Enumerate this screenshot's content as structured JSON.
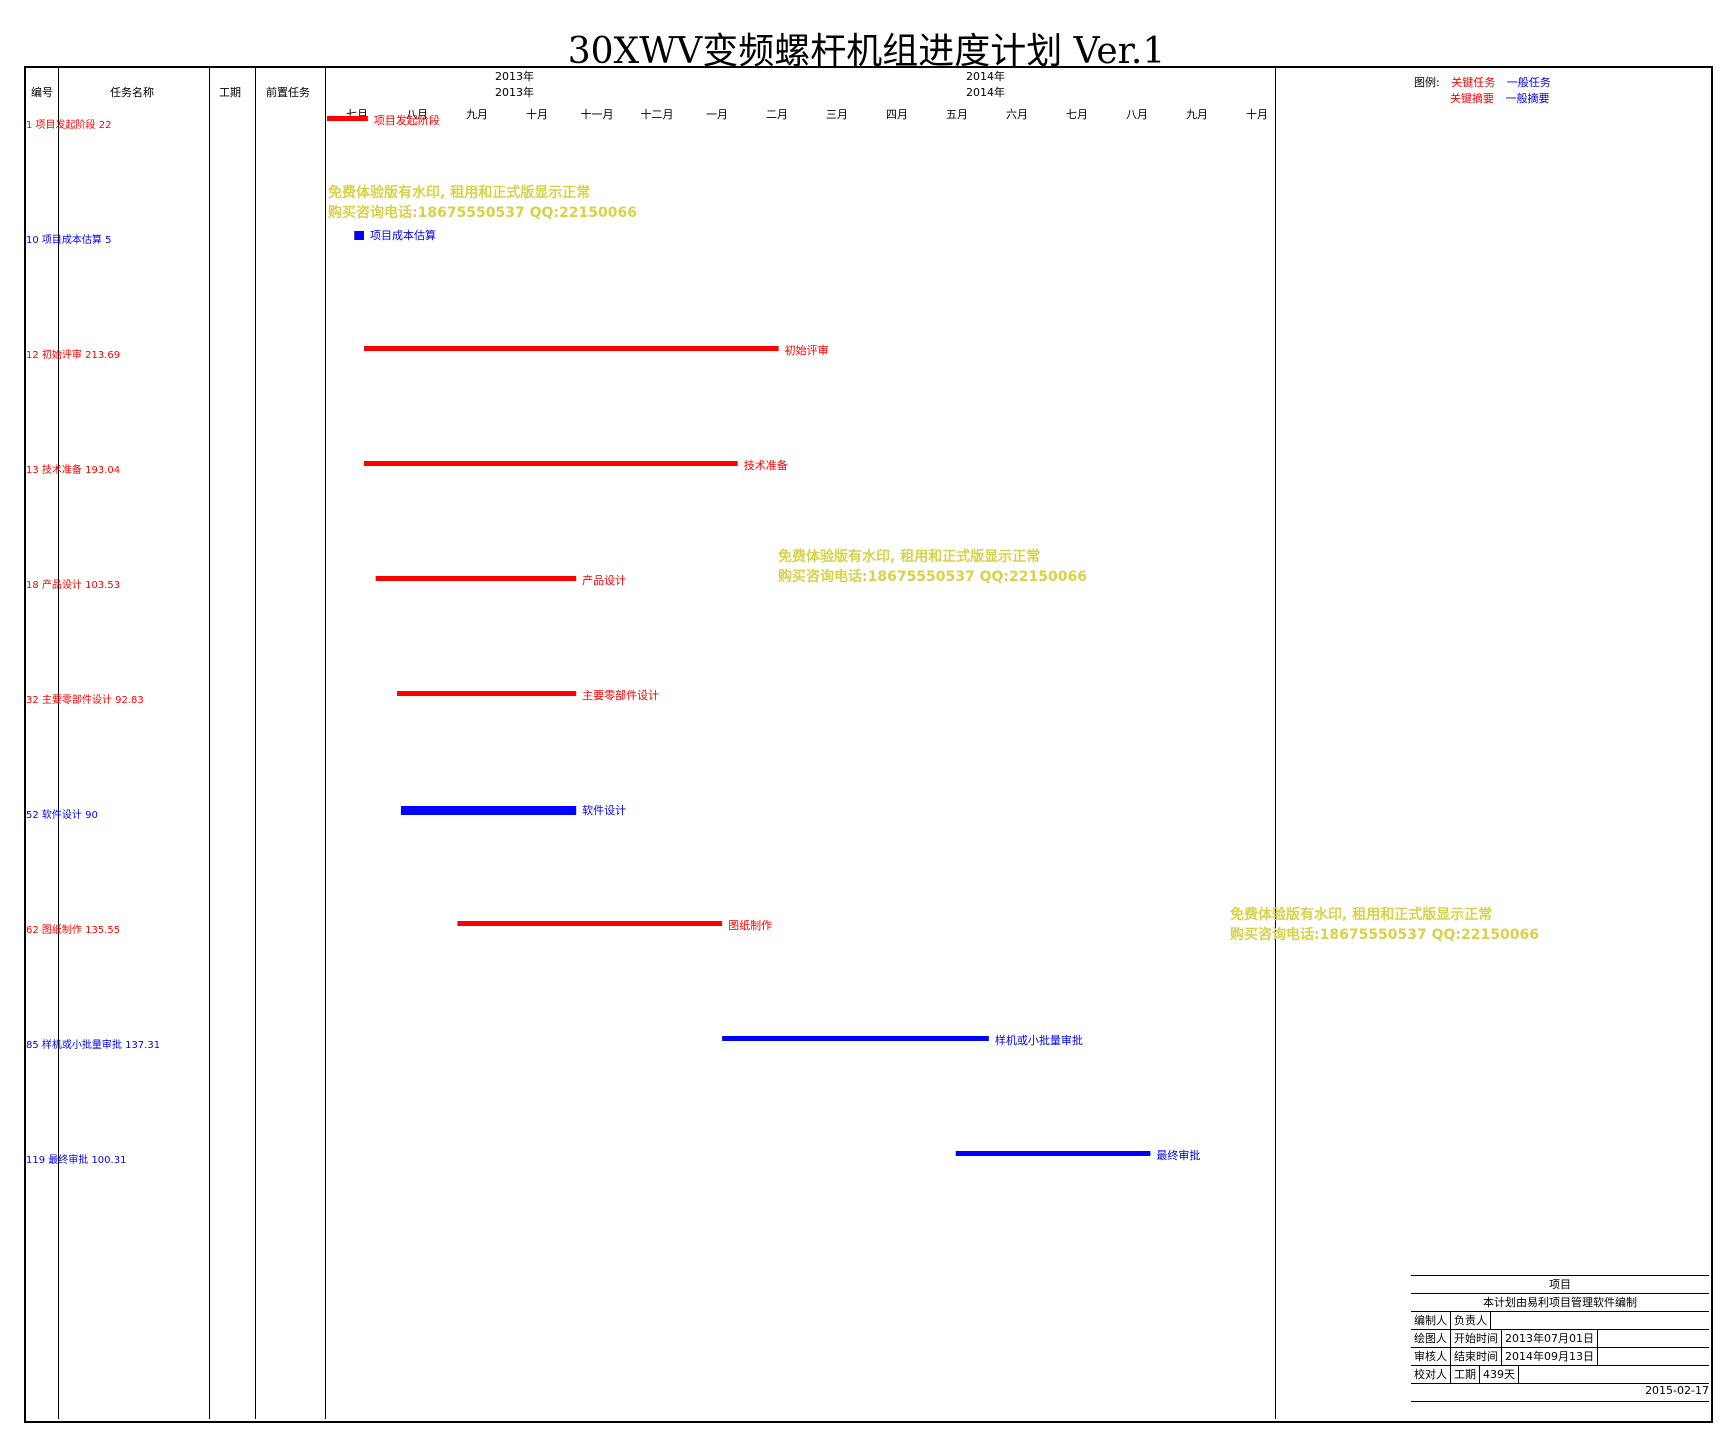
{
  "title": "30XWV变频螺杆机组进度计划 Ver.1",
  "columns": [
    "编号",
    "任务名称",
    "工期",
    "前置任务"
  ],
  "years": [
    "2013年",
    "2013年",
    "2014年",
    "2014年"
  ],
  "months": [
    "七月",
    "八月",
    "九月",
    "十月",
    "十一月",
    "十二月",
    "一月",
    "二月",
    "三月",
    "四月",
    "五月",
    "六月",
    "七月",
    "八月",
    "九月",
    "十月"
  ],
  "legend": {
    "label": "图例:",
    "critical_task": "关键任务",
    "critical_summary": "关键摘要",
    "normal_task": "一般任务",
    "normal_summary": "一般摘要",
    "critical_color": "#ff0000",
    "normal_color": "#0000ff"
  },
  "watermark": {
    "line1": "免费体验版有水印, 租用和正式版显示正常",
    "line2": "购买咨询电话:18675550537 QQ:22150066"
  },
  "info": {
    "project_label": "项目",
    "note": "本计划由易利项目管理软件编制",
    "editor_label": "编制人",
    "owner_label": "负责人",
    "drawer_label": "绘图人",
    "start_label": "开始时间",
    "start_value": "2013年07月01日",
    "reviewer_label": "审核人",
    "end_label": "结束时间",
    "end_value": "2014年09月13日",
    "checker_label": "校对人",
    "duration_label": "工期",
    "duration_value": "439天",
    "date": "2015-02-17"
  },
  "chart_data": {
    "type": "gantt",
    "start": "2013-07-01",
    "end": "2014-10-31",
    "tasks": [
      {
        "id": "1",
        "name": "项目发起阶段",
        "duration": "22",
        "start": "2013-07-01",
        "end": "2013-07-22",
        "critical": true,
        "summary": true
      },
      {
        "id": "10",
        "name": "项目成本估算",
        "duration": "5",
        "start": "2013-07-15",
        "end": "2013-07-20",
        "critical": false,
        "summary": false
      },
      {
        "id": "12",
        "name": "初始评审",
        "duration": "213.69",
        "start": "2013-07-20",
        "end": "2014-02-18",
        "critical": true,
        "summary": true
      },
      {
        "id": "13",
        "name": "技术准备",
        "duration": "193.04",
        "start": "2013-07-20",
        "end": "2014-01-28",
        "critical": true,
        "summary": true
      },
      {
        "id": "18",
        "name": "产品设计",
        "duration": "103.53",
        "start": "2013-07-26",
        "end": "2013-11-06",
        "critical": true,
        "summary": true
      },
      {
        "id": "32",
        "name": "主要零部件设计",
        "duration": "92.83",
        "start": "2013-08-06",
        "end": "2013-11-06",
        "critical": true,
        "summary": true
      },
      {
        "id": "52",
        "name": "软件设计",
        "duration": "90",
        "start": "2013-08-08",
        "end": "2013-11-06",
        "critical": false,
        "summary": false
      },
      {
        "id": "62",
        "name": "图纸制作",
        "duration": "135.55",
        "start": "2013-09-06",
        "end": "2014-01-20",
        "critical": true,
        "summary": true
      },
      {
        "id": "85",
        "name": "样机或小批量审批",
        "duration": "137.31",
        "start": "2014-01-20",
        "end": "2014-06-06",
        "critical": false,
        "summary": true
      },
      {
        "id": "119",
        "name": "最终审批",
        "duration": "100.31",
        "start": "2014-05-20",
        "end": "2014-08-28",
        "critical": false,
        "summary": true
      }
    ]
  }
}
